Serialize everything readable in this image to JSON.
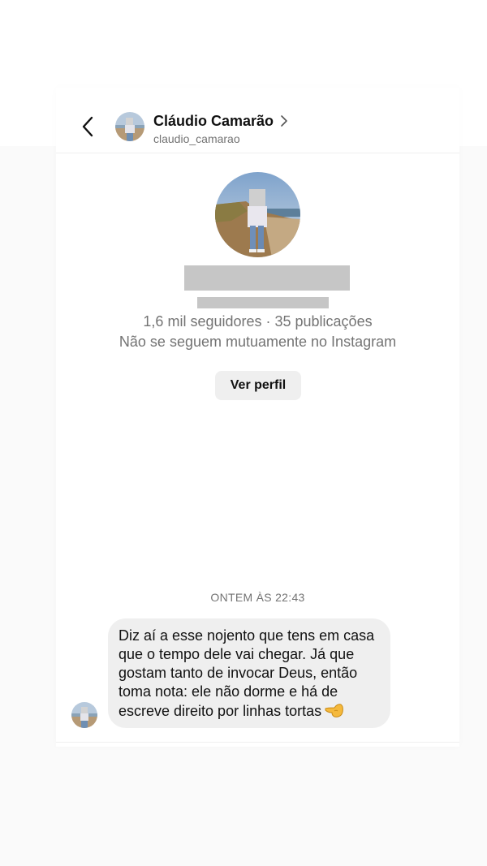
{
  "header": {
    "name": "Cláudio Camarão",
    "handle": "claudio_camarao",
    "back_icon": "chevron-left-icon",
    "name_chevron_icon": "chevron-right-icon"
  },
  "profile": {
    "stats": "1,6 mil seguidores · 35 publicações",
    "mutual": "Não se seguem mutuamente no Instagram",
    "view_profile_button": "Ver perfil"
  },
  "conversation": {
    "timestamp": "ONTEM ÀS 22:43",
    "messages": [
      {
        "text": "Diz aí a esse nojento que tens em casa que o tempo dele vai chegar. Já que gostam tanto de invocar Deus, então toma nota: ele não dorme e há de escreve direito por linhas tortas",
        "emoji": "hand-pointing-left-emoji"
      }
    ]
  },
  "colors": {
    "background": "#fafafa",
    "panel": "#ffffff",
    "bubble": "#efefef",
    "secondary_text": "#737373",
    "redaction": "#c6c6c6"
  }
}
